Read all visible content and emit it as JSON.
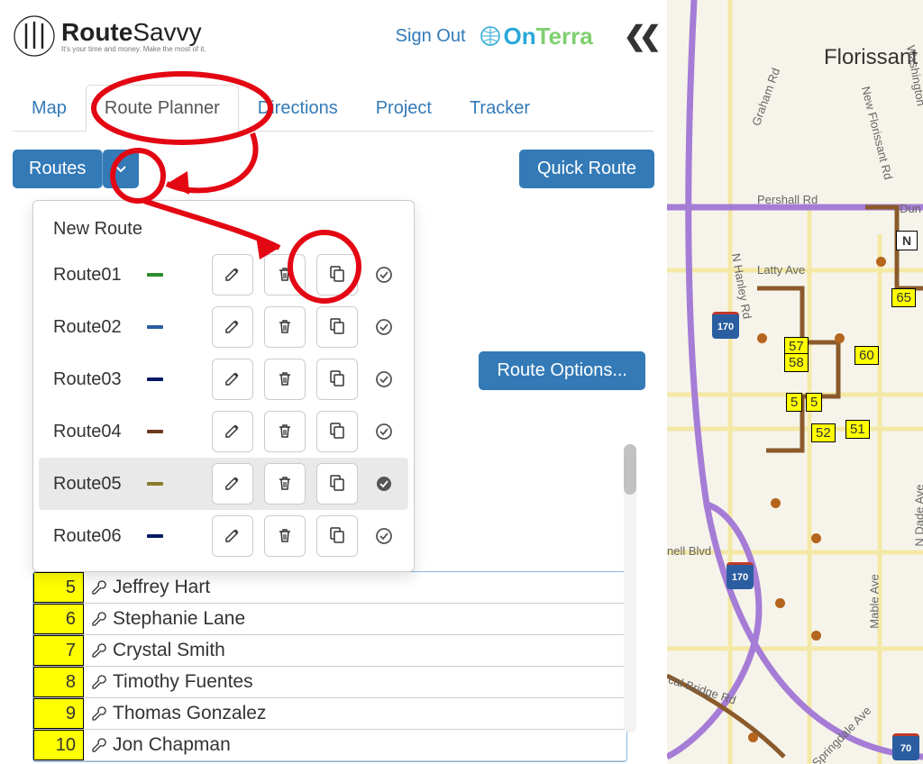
{
  "header": {
    "logo_main": "Route",
    "logo_secondary": "Savvy",
    "logo_tagline": "It's your time and money. Make the most of it.",
    "sign_out": "Sign Out",
    "brand_on": "On",
    "brand_terra": "Terra"
  },
  "tabs": {
    "map": "Map",
    "route_planner": "Route Planner",
    "directions": "Directions",
    "project": "Project",
    "tracker": "Tracker",
    "active": "route_planner"
  },
  "toolbar": {
    "routes_label": "Routes",
    "quick_route_label": "Quick Route",
    "route_options_label": "Route Options..."
  },
  "routes_dropdown": {
    "new_route_label": "New Route",
    "items": [
      {
        "name": "Route01",
        "color": "#2e8b2e",
        "selected": false
      },
      {
        "name": "Route02",
        "color": "#2a5ea1",
        "selected": false
      },
      {
        "name": "Route03",
        "color": "#001a66",
        "selected": false
      },
      {
        "name": "Route04",
        "color": "#6b3a1f",
        "selected": false
      },
      {
        "name": "Route05",
        "color": "#8b7a2b",
        "selected": true
      },
      {
        "name": "Route06",
        "color": "#001a66",
        "selected": false
      }
    ]
  },
  "stops": [
    {
      "num": "5",
      "name": "Jeffrey Hart"
    },
    {
      "num": "6",
      "name": "Stephanie Lane"
    },
    {
      "num": "7",
      "name": "Crystal Smith"
    },
    {
      "num": "8",
      "name": "Timothy Fuentes"
    },
    {
      "num": "9",
      "name": "Thomas Gonzalez"
    },
    {
      "num": "10",
      "name": "Jon Chapman"
    }
  ],
  "map": {
    "city_label": "Florissant",
    "roads": {
      "graham": "Graham Rd",
      "washington": "Washington",
      "new_florissant": "New Florissant Rd",
      "pershall": "Pershall Rd",
      "dun": "Dun",
      "latty": "Latty Ave",
      "n_hanley": "N Hanley Rd",
      "n_dade": "N Dade Ave",
      "nell_blvd": "nell Blvd",
      "mable": "Mable Ave",
      "bridge": "cal Bridge Rd",
      "springdale": "Springdale Ave"
    },
    "shields": {
      "i170_top": "170",
      "i170_mid": "170",
      "i70": "70",
      "n": "N"
    },
    "markers": [
      "65",
      "57",
      "58",
      "60",
      "5",
      "5",
      "52",
      "51"
    ]
  }
}
